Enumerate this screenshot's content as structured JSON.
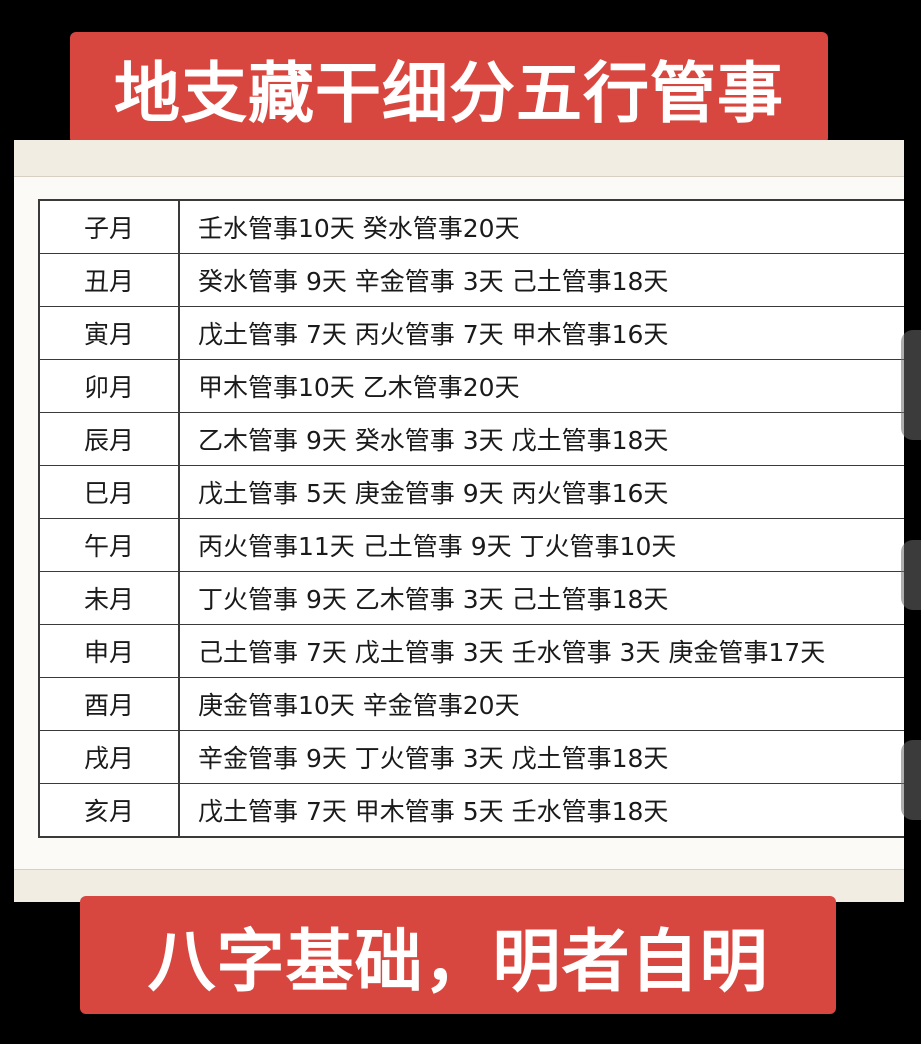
{
  "title": "地支藏干细分五行管事",
  "footer": "八字基础，明者自明",
  "colors": {
    "banner": "#d8473f",
    "banner_text": "#ffffff",
    "background": "#000000",
    "paper": "#f1ede3"
  },
  "rows": [
    {
      "month": "子月",
      "detail": "壬水管事10天  癸水管事20天"
    },
    {
      "month": "丑月",
      "detail": "癸水管事 9天  辛金管事  3天  己土管事18天"
    },
    {
      "month": "寅月",
      "detail": "戊土管事 7天  丙火管事  7天  甲木管事16天"
    },
    {
      "month": "卯月",
      "detail": "甲木管事10天  乙木管事20天"
    },
    {
      "month": "辰月",
      "detail": "乙木管事 9天  癸水管事 3天  戊土管事18天"
    },
    {
      "month": "巳月",
      "detail": "戊土管事 5天  庚金管事 9天  丙火管事16天"
    },
    {
      "month": "午月",
      "detail": "丙火管事11天  己土管事 9天  丁火管事10天"
    },
    {
      "month": "未月",
      "detail": "丁火管事 9天  乙木管事 3天  己土管事18天"
    },
    {
      "month": "申月",
      "detail": "己土管事 7天  戊土管事 3天  壬水管事 3天   庚金管事17天"
    },
    {
      "month": "酉月",
      "detail": "庚金管事10天  辛金管事20天"
    },
    {
      "month": "戌月",
      "detail": "辛金管事 9天  丁火管事 3天  戊土管事18天"
    },
    {
      "month": "亥月",
      "detail": "戊土管事 7天  甲木管事 5天  壬水管事18天"
    }
  ]
}
